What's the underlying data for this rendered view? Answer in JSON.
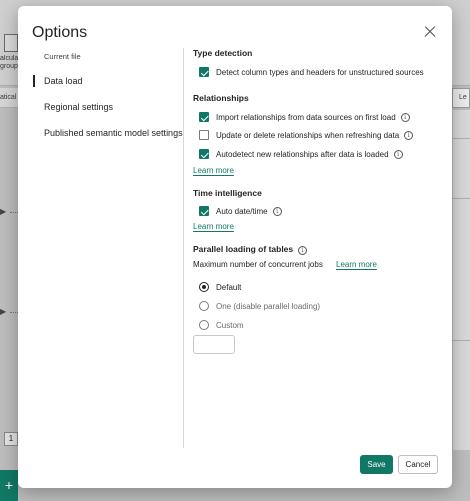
{
  "background": {
    "calc_label": "alcula group",
    "left_strip_text": "atical",
    "right_strip_text": "Le",
    "page_number": "1",
    "add_button": "+"
  },
  "dialog": {
    "title": "Options",
    "close_icon": "close-icon",
    "nav": {
      "heading": "Current file",
      "items": [
        {
          "label": "Data load",
          "active": true
        },
        {
          "label": "Regional settings",
          "active": false
        },
        {
          "label": "Published semantic model settings",
          "active": false
        }
      ]
    },
    "type_detection": {
      "title": "Type detection",
      "option": {
        "label": "Detect column types and headers for unstructured sources",
        "checked": true
      }
    },
    "relationships": {
      "title": "Relationships",
      "options": [
        {
          "label": "Import relationships from data sources on first load",
          "checked": true,
          "info": true
        },
        {
          "label": "Update or delete relationships when refreshing data",
          "checked": false,
          "info": true
        },
        {
          "label": "Autodetect new relationships after data is loaded",
          "checked": true,
          "info": true
        }
      ],
      "learn_more": "Learn more"
    },
    "time_intelligence": {
      "title": "Time intelligence",
      "option": {
        "label": "Auto date/time",
        "checked": true,
        "info": true
      },
      "learn_more": "Learn more"
    },
    "parallel_loading": {
      "title": "Parallel loading of tables",
      "subtitle": "Maximum number of concurrent jobs",
      "learn_more": "Learn more",
      "options": [
        {
          "label": "Default",
          "selected": true
        },
        {
          "label": "One (disable parallel loading)",
          "selected": false
        },
        {
          "label": "Custom",
          "selected": false
        }
      ],
      "custom_value": ""
    },
    "save_label": "Save",
    "cancel_label": "Cancel",
    "accent_color": "#117865"
  }
}
